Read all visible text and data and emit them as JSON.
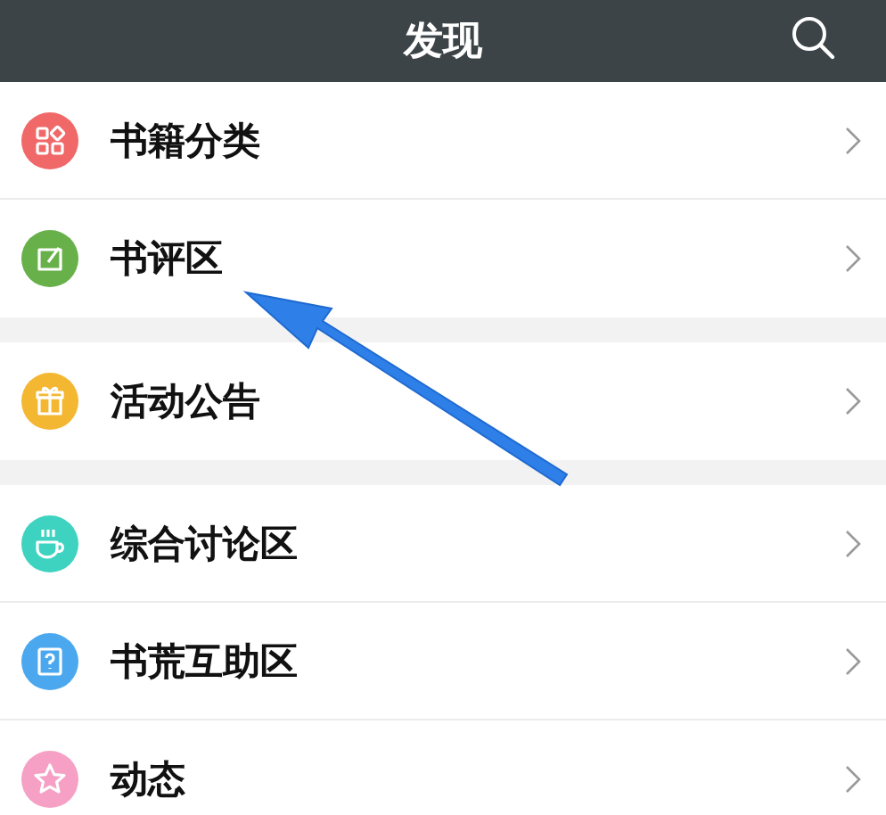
{
  "header": {
    "title": "发现"
  },
  "sections": [
    {
      "items": [
        {
          "label": "书籍分类",
          "kind": "grid",
          "color": "#f06868"
        },
        {
          "label": "书评区",
          "kind": "edit",
          "color": "#68b04a"
        }
      ]
    },
    {
      "items": [
        {
          "label": "活动公告",
          "kind": "gift",
          "color": "#f4b732"
        }
      ]
    },
    {
      "items": [
        {
          "label": "综合讨论区",
          "kind": "cup",
          "color": "#3ed3c0"
        },
        {
          "label": "书荒互助区",
          "kind": "book",
          "color": "#4ba8ef"
        },
        {
          "label": "动态",
          "kind": "star",
          "color": "#f5a0c4"
        }
      ]
    }
  ]
}
